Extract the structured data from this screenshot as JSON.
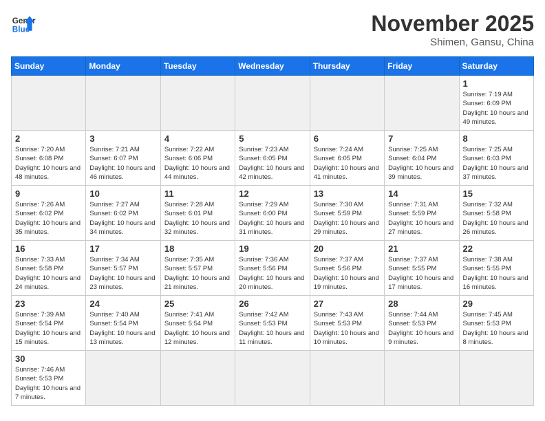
{
  "header": {
    "logo_general": "General",
    "logo_blue": "Blue",
    "month_title": "November 2025",
    "subtitle": "Shimen, Gansu, China"
  },
  "days_of_week": [
    "Sunday",
    "Monday",
    "Tuesday",
    "Wednesday",
    "Thursday",
    "Friday",
    "Saturday"
  ],
  "weeks": [
    [
      {
        "day": "",
        "info": ""
      },
      {
        "day": "",
        "info": ""
      },
      {
        "day": "",
        "info": ""
      },
      {
        "day": "",
        "info": ""
      },
      {
        "day": "",
        "info": ""
      },
      {
        "day": "",
        "info": ""
      },
      {
        "day": "1",
        "info": "Sunrise: 7:19 AM\nSunset: 6:09 PM\nDaylight: 10 hours\nand 49 minutes."
      }
    ],
    [
      {
        "day": "2",
        "info": "Sunrise: 7:20 AM\nSunset: 6:08 PM\nDaylight: 10 hours\nand 48 minutes."
      },
      {
        "day": "3",
        "info": "Sunrise: 7:21 AM\nSunset: 6:07 PM\nDaylight: 10 hours\nand 46 minutes."
      },
      {
        "day": "4",
        "info": "Sunrise: 7:22 AM\nSunset: 6:06 PM\nDaylight: 10 hours\nand 44 minutes."
      },
      {
        "day": "5",
        "info": "Sunrise: 7:23 AM\nSunset: 6:05 PM\nDaylight: 10 hours\nand 42 minutes."
      },
      {
        "day": "6",
        "info": "Sunrise: 7:24 AM\nSunset: 6:05 PM\nDaylight: 10 hours\nand 41 minutes."
      },
      {
        "day": "7",
        "info": "Sunrise: 7:25 AM\nSunset: 6:04 PM\nDaylight: 10 hours\nand 39 minutes."
      },
      {
        "day": "8",
        "info": "Sunrise: 7:25 AM\nSunset: 6:03 PM\nDaylight: 10 hours\nand 37 minutes."
      }
    ],
    [
      {
        "day": "9",
        "info": "Sunrise: 7:26 AM\nSunset: 6:02 PM\nDaylight: 10 hours\nand 35 minutes."
      },
      {
        "day": "10",
        "info": "Sunrise: 7:27 AM\nSunset: 6:02 PM\nDaylight: 10 hours\nand 34 minutes."
      },
      {
        "day": "11",
        "info": "Sunrise: 7:28 AM\nSunset: 6:01 PM\nDaylight: 10 hours\nand 32 minutes."
      },
      {
        "day": "12",
        "info": "Sunrise: 7:29 AM\nSunset: 6:00 PM\nDaylight: 10 hours\nand 31 minutes."
      },
      {
        "day": "13",
        "info": "Sunrise: 7:30 AM\nSunset: 5:59 PM\nDaylight: 10 hours\nand 29 minutes."
      },
      {
        "day": "14",
        "info": "Sunrise: 7:31 AM\nSunset: 5:59 PM\nDaylight: 10 hours\nand 27 minutes."
      },
      {
        "day": "15",
        "info": "Sunrise: 7:32 AM\nSunset: 5:58 PM\nDaylight: 10 hours\nand 26 minutes."
      }
    ],
    [
      {
        "day": "16",
        "info": "Sunrise: 7:33 AM\nSunset: 5:58 PM\nDaylight: 10 hours\nand 24 minutes."
      },
      {
        "day": "17",
        "info": "Sunrise: 7:34 AM\nSunset: 5:57 PM\nDaylight: 10 hours\nand 23 minutes."
      },
      {
        "day": "18",
        "info": "Sunrise: 7:35 AM\nSunset: 5:57 PM\nDaylight: 10 hours\nand 21 minutes."
      },
      {
        "day": "19",
        "info": "Sunrise: 7:36 AM\nSunset: 5:56 PM\nDaylight: 10 hours\nand 20 minutes."
      },
      {
        "day": "20",
        "info": "Sunrise: 7:37 AM\nSunset: 5:56 PM\nDaylight: 10 hours\nand 19 minutes."
      },
      {
        "day": "21",
        "info": "Sunrise: 7:37 AM\nSunset: 5:55 PM\nDaylight: 10 hours\nand 17 minutes."
      },
      {
        "day": "22",
        "info": "Sunrise: 7:38 AM\nSunset: 5:55 PM\nDaylight: 10 hours\nand 16 minutes."
      }
    ],
    [
      {
        "day": "23",
        "info": "Sunrise: 7:39 AM\nSunset: 5:54 PM\nDaylight: 10 hours\nand 15 minutes."
      },
      {
        "day": "24",
        "info": "Sunrise: 7:40 AM\nSunset: 5:54 PM\nDaylight: 10 hours\nand 13 minutes."
      },
      {
        "day": "25",
        "info": "Sunrise: 7:41 AM\nSunset: 5:54 PM\nDaylight: 10 hours\nand 12 minutes."
      },
      {
        "day": "26",
        "info": "Sunrise: 7:42 AM\nSunset: 5:53 PM\nDaylight: 10 hours\nand 11 minutes."
      },
      {
        "day": "27",
        "info": "Sunrise: 7:43 AM\nSunset: 5:53 PM\nDaylight: 10 hours\nand 10 minutes."
      },
      {
        "day": "28",
        "info": "Sunrise: 7:44 AM\nSunset: 5:53 PM\nDaylight: 10 hours\nand 9 minutes."
      },
      {
        "day": "29",
        "info": "Sunrise: 7:45 AM\nSunset: 5:53 PM\nDaylight: 10 hours\nand 8 minutes."
      }
    ],
    [
      {
        "day": "30",
        "info": "Sunrise: 7:46 AM\nSunset: 5:53 PM\nDaylight: 10 hours\nand 7 minutes."
      },
      {
        "day": "",
        "info": ""
      },
      {
        "day": "",
        "info": ""
      },
      {
        "day": "",
        "info": ""
      },
      {
        "day": "",
        "info": ""
      },
      {
        "day": "",
        "info": ""
      },
      {
        "day": "",
        "info": ""
      }
    ]
  ]
}
